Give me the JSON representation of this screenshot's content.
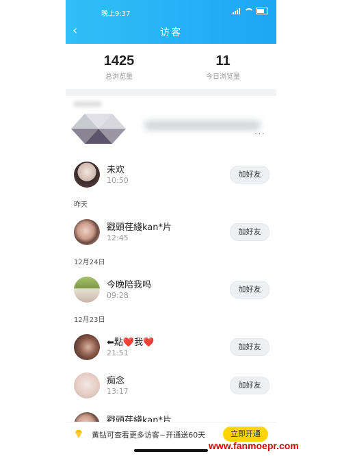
{
  "status_bar": {
    "time": "晚上9:37"
  },
  "nav": {
    "title": "访客"
  },
  "stats": {
    "total": {
      "value": "1425",
      "label": "总浏览量"
    },
    "today": {
      "value": "11",
      "label": "今日浏览量"
    }
  },
  "visitors": [
    {
      "name": "未欢",
      "time": "10:50",
      "action": "加好友"
    },
    {
      "name": "戳頭荏綫kan*片",
      "time": "12:45",
      "action": "加好友"
    },
    {
      "name": "今晚陪我吗",
      "time": "09:28",
      "action": "加好友"
    },
    {
      "name": "⬅點❤️我❤️",
      "time": "21:51",
      "action": "加好友"
    },
    {
      "name": "痴念",
      "time": "13:17",
      "action": "加好友"
    },
    {
      "name": "戳頭荏綫kan*片",
      "time": "",
      "action": ""
    }
  ],
  "dates": [
    "昨天",
    "12月24日",
    "12月23日"
  ],
  "banner": {
    "text": "黄钻可查看更多访客~开通送60天",
    "button": "立即开通"
  },
  "watermark": "www.fanmoepr.com",
  "colors": {
    "header": "#1aa7f5",
    "accent": "#ffd400"
  }
}
